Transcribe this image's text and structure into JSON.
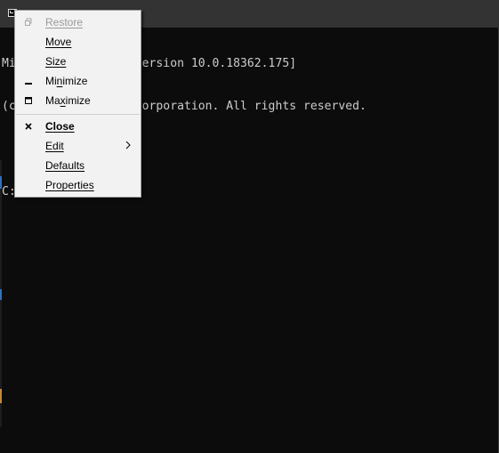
{
  "console": {
    "lines": [
      "Microsoft Windows [Version 10.0.18362.175]",
      "(c) 2019 Microsoft Corporation. All rights reserved.",
      "",
      "C:\\>"
    ]
  },
  "menu": {
    "items": [
      {
        "first": "R",
        "rest": "estore"
      },
      {
        "first": "M",
        "rest": "ove"
      },
      {
        "first": "S",
        "rest": "ize"
      },
      {
        "first": "",
        "mid_before": "Mi",
        "ul": "n",
        "mid_after": "imize"
      },
      {
        "first": "",
        "mid_before": "Ma",
        "ul": "x",
        "mid_after": "imize"
      },
      {
        "first": "C",
        "rest": "lose"
      },
      {
        "first": "E",
        "rest": "dit"
      },
      {
        "first": "D",
        "rest": "efaults"
      },
      {
        "first": "P",
        "rest": "roperties"
      }
    ]
  },
  "colors": {
    "terminal_bg": "#0c0c0c",
    "terminal_text": "#cccccc",
    "titlebar": "#333333",
    "menu_bg": "#f2f2f2",
    "disabled_text": "#9a9a9a"
  }
}
